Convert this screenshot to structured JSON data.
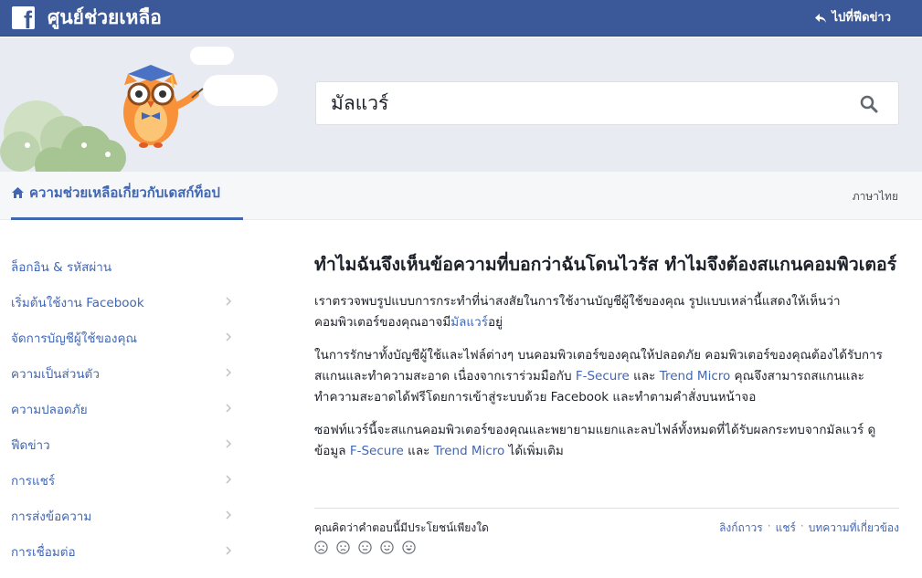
{
  "header": {
    "logo_letter": "f",
    "title": "ศูนย์ช่วยเหลือ",
    "back_label": "ไปที่ฟีดข่าว"
  },
  "search": {
    "value": "มัลแวร์"
  },
  "nav": {
    "tab_label": "ความช่วยเหลือเกี่ยวกับเดสก์ท็อป",
    "language": "ภาษาไทย"
  },
  "sidebar": {
    "items": [
      {
        "label": "ล็อกอิน & รหัสผ่าน"
      },
      {
        "label": "เริ่มต้นใช้งาน Facebook"
      },
      {
        "label": "จัดการบัญชีผู้ใช้ของคุณ"
      },
      {
        "label": "ความเป็นส่วนตัว"
      },
      {
        "label": "ความปลอดภัย"
      },
      {
        "label": "ฟีดข่าว"
      },
      {
        "label": "การแชร์"
      },
      {
        "label": "การส่งข้อความ"
      },
      {
        "label": "การเชื่อมต่อ"
      }
    ]
  },
  "article": {
    "title": "ทำไมฉันจึงเห็นข้อความที่บอกว่าฉันโดนไวรัส ทำไมจึงต้องสแกนคอมพิวเตอร์",
    "p1_text": "เราตรวจพบรูปแบบการกระทำที่น่าสงสัยในการใช้งานบัญชีผู้ใช้ของคุณ รูปแบบเหล่านี้แสดงให้เห็นว่าคอมพิวเตอร์ของคุณอาจมี",
    "p1_link": "มัลแวร์",
    "p1_end": "อยู่",
    "p2_a": "ในการรักษาทั้งบัญชีผู้ใช้และไฟล์ต่างๆ บนคอมพิวเตอร์ของคุณให้ปลอดภัย คอมพิวเตอร์ของคุณต้องได้รับการสแกนและทำความสะอาด เนื่องจากเราร่วมมือกับ ",
    "p2_link1": "F-Secure",
    "p2_b": " และ ",
    "p2_link2": "Trend Micro",
    "p2_c": " คุณจึงสามารถสแกนและทำความสะอาดได้ฟรีโดยการเข้าสู่ระบบด้วย Facebook และทำตามคำสั่งบนหน้าจอ",
    "p3_a": "ซอฟท์แวร์นี้จะสแกนคอมพิวเตอร์ของคุณและพยายามแยกและลบไฟล์ทั้งหมดที่ได้รับผลกระทบจากมัลแวร์ ดูข้อมูล ",
    "p3_link1": "F-Secure",
    "p3_b": " และ ",
    "p3_link2": "Trend Micro",
    "p3_c": " ได้เพิ่มเติม"
  },
  "feedback": {
    "question": "คุณคิดว่าคำตอบนี้มีประโยชน์เพียงใด",
    "links": {
      "permalink": "ลิงก์ถาวร",
      "share": "แชร์",
      "related": "บทความที่เกี่ยวข้อง",
      "separator": "·"
    },
    "faces": [
      "very-sad-face-icon",
      "sad-face-icon",
      "neutral-face-icon",
      "happy-face-icon",
      "very-happy-face-icon"
    ]
  },
  "colors": {
    "brand_blue": "#3b5998",
    "link_blue": "#4267b2",
    "hero_bg": "#e9ebf2"
  }
}
